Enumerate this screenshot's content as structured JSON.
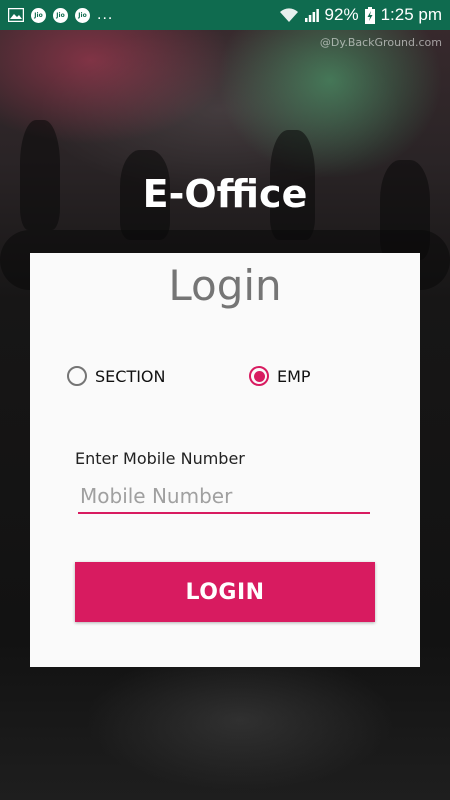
{
  "status_bar": {
    "notification_icons": [
      "image-icon",
      "jio-icon",
      "jio-icon",
      "jio-icon"
    ],
    "jio_label": "Jio",
    "ellipsis": "...",
    "battery_percent": "92%",
    "time": "1:25 pm",
    "background_color": "#0f6b4f"
  },
  "watermark": "@Dy.BackGround.com",
  "app": {
    "title": "E-Office"
  },
  "login_card": {
    "title": "Login",
    "radio_options": [
      {
        "label": "SECTION",
        "checked": false
      },
      {
        "label": "EMP",
        "checked": true
      }
    ],
    "mobile_label": "Enter Mobile Number",
    "mobile_placeholder": "Mobile Number",
    "mobile_value": "",
    "login_button_label": "LOGIN"
  },
  "colors": {
    "accent": "#d81b60",
    "card_background": "#fafafa",
    "title_text": "#757575"
  }
}
